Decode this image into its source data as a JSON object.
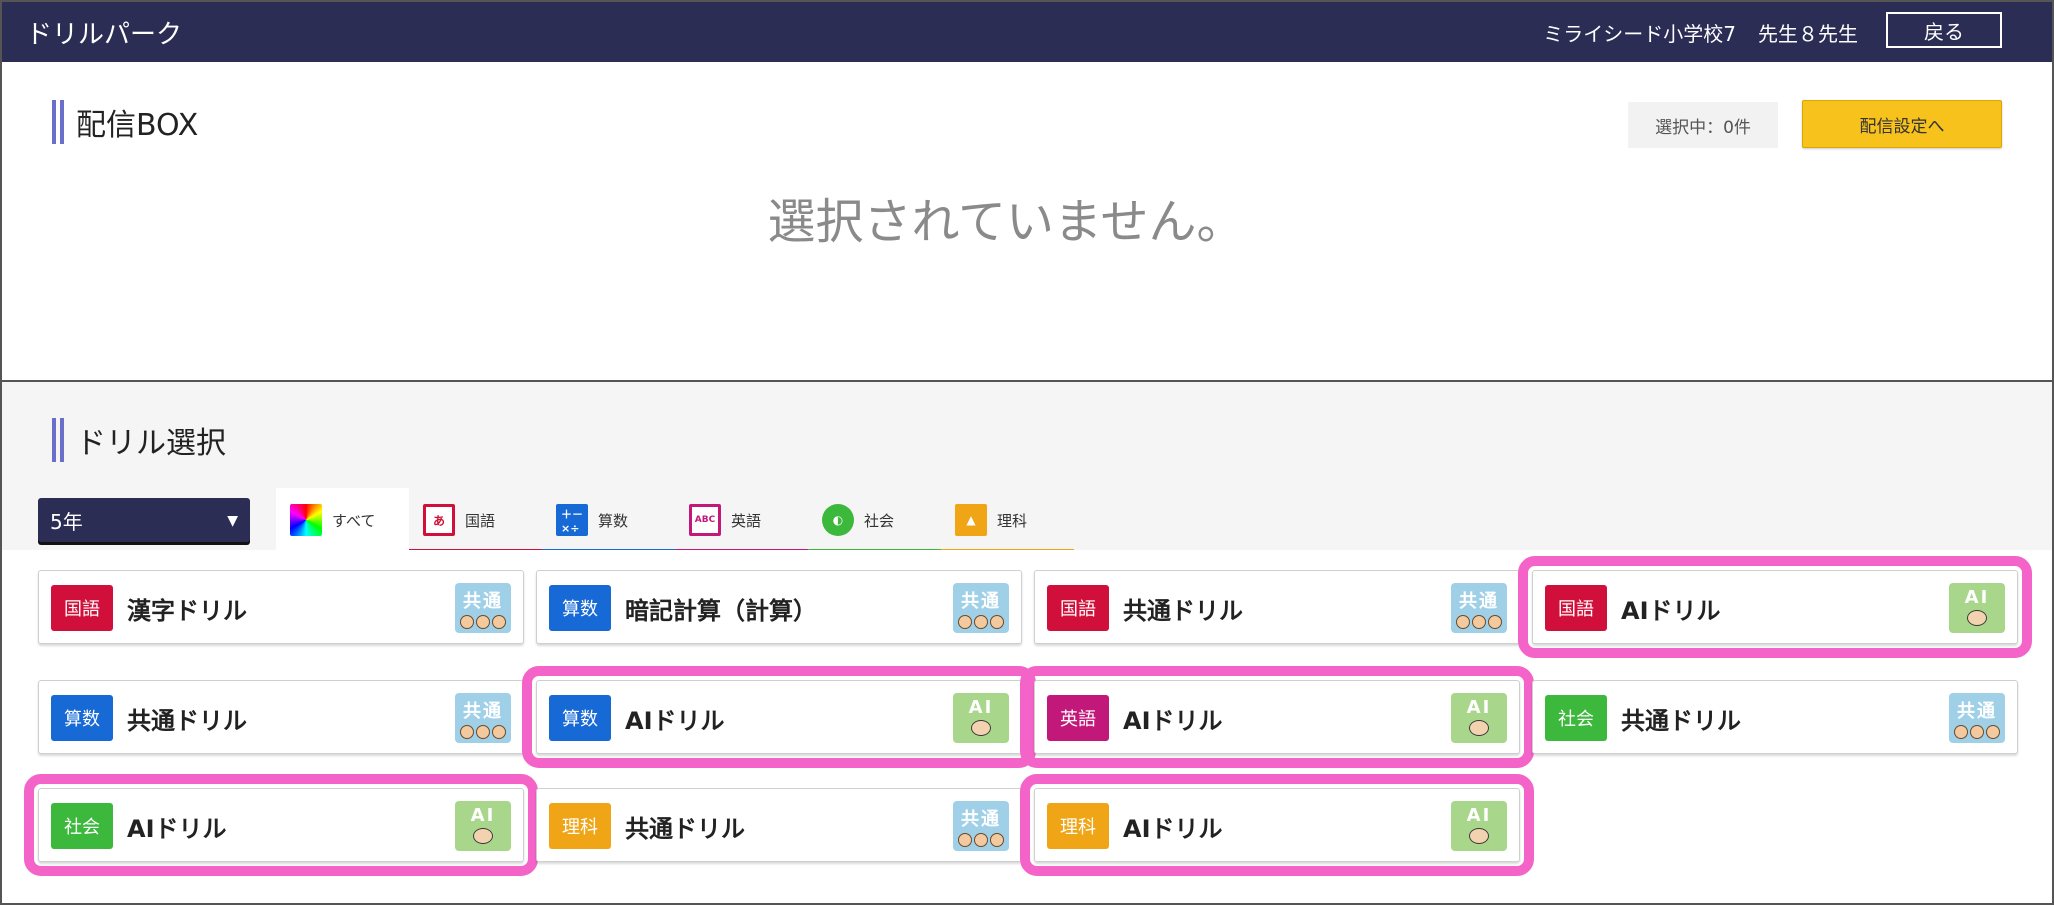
{
  "header": {
    "app_title": "ドリルパーク",
    "school": "ミライシード小学校7",
    "teacher": "先生８先生",
    "back_label": "戻る"
  },
  "delivery_box": {
    "title": "配信BOX",
    "selected_count": "選択中：0件",
    "settings_button": "配信設定へ",
    "empty_message": "選択されていません。"
  },
  "drill_select": {
    "title": "ドリル選択",
    "grade": "5年",
    "tabs": [
      {
        "label": "すべて",
        "icon": "rainbow-icon",
        "color": "#ffffff"
      },
      {
        "label": "国語",
        "icon": "kokugo-icon",
        "color": "#d0103a"
      },
      {
        "label": "算数",
        "icon": "sansu-icon",
        "color": "#1769d6"
      },
      {
        "label": "英語",
        "icon": "eigo-icon",
        "color": "#c2187a"
      },
      {
        "label": "社会",
        "icon": "shakai-icon",
        "color": "#3cb83c"
      },
      {
        "label": "理科",
        "icon": "rika-icon",
        "color": "#f0a516"
      }
    ],
    "cards": [
      {
        "subject": "国語",
        "name": "漢字ドリル",
        "type": "共通",
        "color": "#d0103a"
      },
      {
        "subject": "算数",
        "name": "暗記計算（計算）",
        "type": "共通",
        "color": "#1769d6"
      },
      {
        "subject": "国語",
        "name": "共通ドリル",
        "type": "共通",
        "color": "#d0103a"
      },
      {
        "subject": "国語",
        "name": "AIドリル",
        "type": "AI",
        "color": "#d0103a"
      },
      {
        "subject": "算数",
        "name": "共通ドリル",
        "type": "共通",
        "color": "#1769d6"
      },
      {
        "subject": "算数",
        "name": "AIドリル",
        "type": "AI",
        "color": "#1769d6"
      },
      {
        "subject": "英語",
        "name": "AIドリル",
        "type": "AI",
        "color": "#c2187a"
      },
      {
        "subject": "社会",
        "name": "共通ドリル",
        "type": "共通",
        "color": "#3cb83c"
      },
      {
        "subject": "社会",
        "name": "AIドリル",
        "type": "AI",
        "color": "#3cb83c"
      },
      {
        "subject": "理科",
        "name": "共通ドリル",
        "type": "共通",
        "color": "#f0a516"
      },
      {
        "subject": "理科",
        "name": "AIドリル",
        "type": "AI",
        "color": "#f0a516"
      }
    ]
  },
  "colors": {
    "header_bg": "#2b2d55",
    "highlight": "#f463c8",
    "button_yellow": "#f7c21b"
  }
}
